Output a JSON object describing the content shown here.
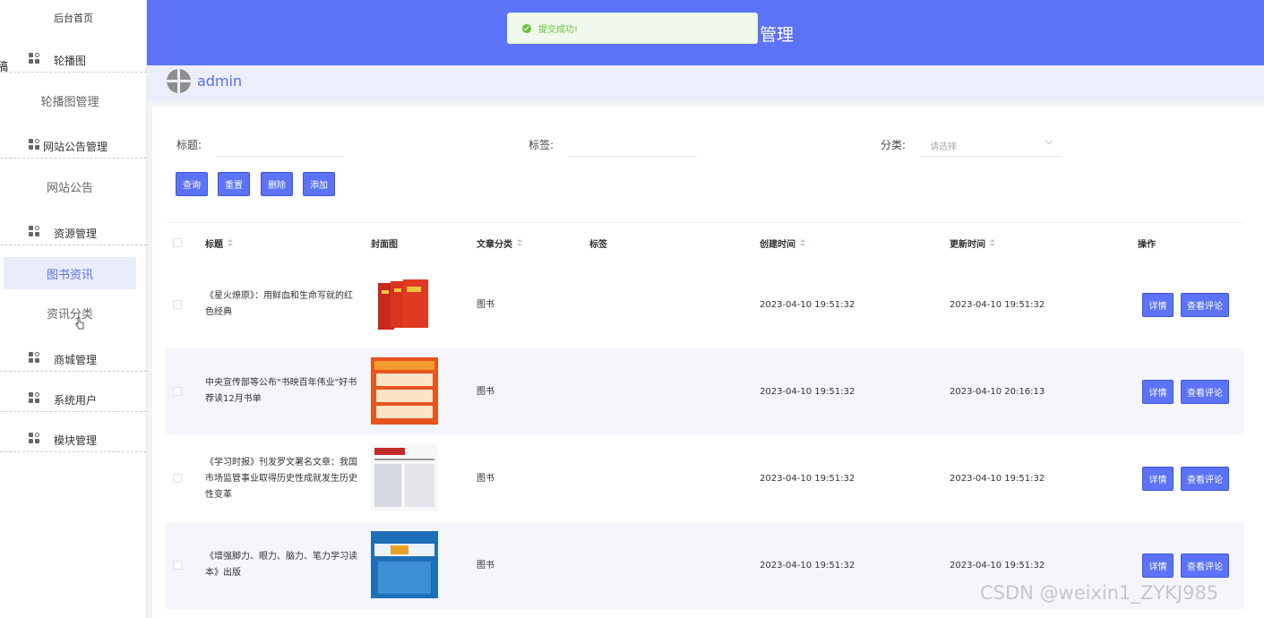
{
  "sidebar": {
    "home": "后台首页",
    "cut_text": "稿",
    "groups": [
      {
        "label": "轮播图"
      },
      {
        "label": "网站公告管理"
      },
      {
        "label": "资源管理"
      },
      {
        "label": "商城管理"
      },
      {
        "label": "系统用户"
      },
      {
        "label": "模块管理"
      }
    ],
    "subs": [
      {
        "label": "轮播图管理"
      },
      {
        "label": "网站公告"
      },
      {
        "label": "图书资讯"
      },
      {
        "label": "资讯分类"
      }
    ]
  },
  "header": {
    "title": "管理"
  },
  "toast": {
    "text": "提交成功!",
    "color": "#67c23a"
  },
  "user": {
    "name": "admin"
  },
  "filters": {
    "title_label": "标题:",
    "tag_label": "标签:",
    "category_label": "分类:",
    "category_placeholder": "请选择"
  },
  "buttons": {
    "query": "查询",
    "reset": "重置",
    "delete": "删除",
    "add": "添加"
  },
  "table": {
    "columns": {
      "title": "标题",
      "cover": "封面图",
      "category": "文章分类",
      "tag": "标签",
      "created": "创建时间",
      "updated": "更新时间",
      "actions": "操作"
    },
    "rows": [
      {
        "title": "《星火燎原》：用鲜血和生命写就的红色经典",
        "category": "图书",
        "created": "2023-04-10 19:51:32",
        "updated": "2023-04-10 19:51:32"
      },
      {
        "title": "中央宣传部等公布\"书映百年伟业\"好书荐读12月书单",
        "category": "图书",
        "created": "2023-04-10 19:51:32",
        "updated": "2023-04-10 20:16:13"
      },
      {
        "title": "《学习时报》刊发罗文署名文章：我国市场监管事业取得历史性成就发生历史性变革",
        "category": "图书",
        "created": "2023-04-10 19:51:32",
        "updated": "2023-04-10 19:51:32"
      },
      {
        "title": "《增强脚力、眼力、脑力、笔力学习读本》出版",
        "category": "图书",
        "created": "2023-04-10 19:51:32",
        "updated": "2023-04-10 19:51:32"
      }
    ],
    "detail_label": "详情",
    "comments_label": "查看评论"
  },
  "watermark": "CSDN @weixin1_ZYKJ985",
  "colors": {
    "primary": "#5d73f7",
    "header": "#5d73f7",
    "active_bg": "#e9ecfb"
  }
}
